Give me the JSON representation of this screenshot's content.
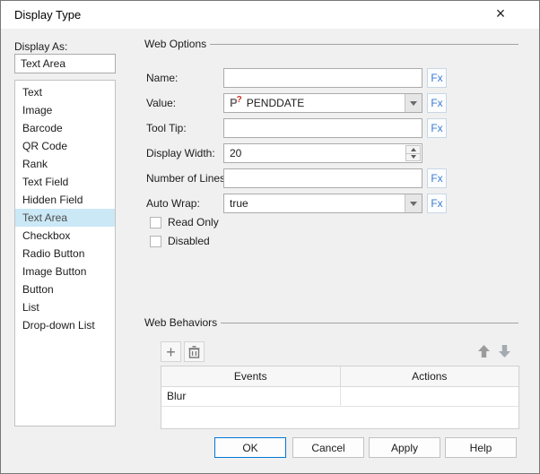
{
  "colors": {
    "accent_blue": "#0078d7",
    "fx_blue": "#3a7bd5",
    "selection_blue": "#cbe8f6",
    "param_mark_red": "#d22d1e",
    "dialog_bg": "#f0f0f1"
  },
  "window": {
    "title": "Display Type",
    "close_glyph": "×"
  },
  "left_panel": {
    "label": "Display As:",
    "current_value": "Text Area",
    "items": [
      "Text",
      "Image",
      "Barcode",
      "QR Code",
      "Rank",
      "Text Field",
      "Hidden Field",
      "Text Area",
      "Checkbox",
      "Radio Button",
      "Image Button",
      "Button",
      "List",
      "Drop-down List"
    ],
    "selected_index": 7
  },
  "web_options": {
    "title": "Web Options",
    "fx_label": "Fx",
    "fields": [
      {
        "label": "Name:",
        "type": "text",
        "value": "",
        "fx": true
      },
      {
        "label": "Value:",
        "type": "combo",
        "value": "PENDDATE",
        "icon_letter": "P",
        "icon_mark": "?",
        "fx": true
      },
      {
        "label": "Tool Tip:",
        "type": "text",
        "value": "",
        "fx": true
      },
      {
        "label": "Display Width:",
        "type": "spinner",
        "value": "20",
        "fx": false
      },
      {
        "label": "Number of Lines:",
        "type": "text",
        "value": "",
        "fx": true
      },
      {
        "label": "Auto Wrap:",
        "type": "combo",
        "value": "true",
        "fx": true
      }
    ],
    "checkboxes": [
      {
        "label": "Read Only",
        "checked": false
      },
      {
        "label": "Disabled",
        "checked": false
      }
    ]
  },
  "web_behaviors": {
    "title": "Web Behaviors",
    "toolbar": {
      "add_glyph": "+"
    },
    "table": {
      "headers": [
        "Events",
        "Actions"
      ],
      "rows": [
        [
          "Blur",
          ""
        ]
      ]
    }
  },
  "footer_buttons": [
    "OK",
    "Cancel",
    "Apply",
    "Help"
  ]
}
